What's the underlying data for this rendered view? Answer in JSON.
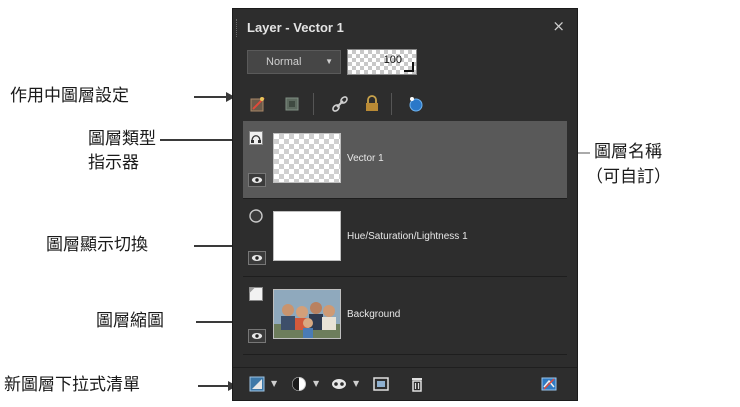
{
  "panel": {
    "title": "Layer - Vector 1",
    "close_glyph": "×",
    "blend_mode": "Normal",
    "opacity": "100",
    "toolbar_icons": [
      "layer-properties-icon",
      "mask-icon",
      "link-icon",
      "lock-icon",
      "color-picker-icon"
    ],
    "layers": [
      {
        "name": "Vector 1",
        "type_icon": "vector-layer-icon",
        "thumbnail": "transparent",
        "selected": true
      },
      {
        "name": "Hue/Saturation/Lightness 1",
        "type_icon": "adjustment-layer-icon",
        "thumbnail": "white",
        "selected": false
      },
      {
        "name": "Background",
        "type_icon": "raster-layer-icon",
        "thumbnail": "photo",
        "selected": false
      }
    ],
    "bottom_icons": [
      "new-layer-icon",
      "adjustment-icon",
      "mask-icon",
      "group-icon",
      "delete-icon",
      "properties-icon"
    ]
  },
  "callouts": {
    "active_settings": "作用中圖層設定",
    "layer_type_1": "圖層類型",
    "layer_type_2": "指示器",
    "visibility": "圖層顯示切換",
    "thumbnail": "圖層縮圖",
    "new_layer": "新圖層下拉式清單",
    "layer_name_1": "圖層名稱",
    "layer_name_2": "（可自訂）"
  }
}
